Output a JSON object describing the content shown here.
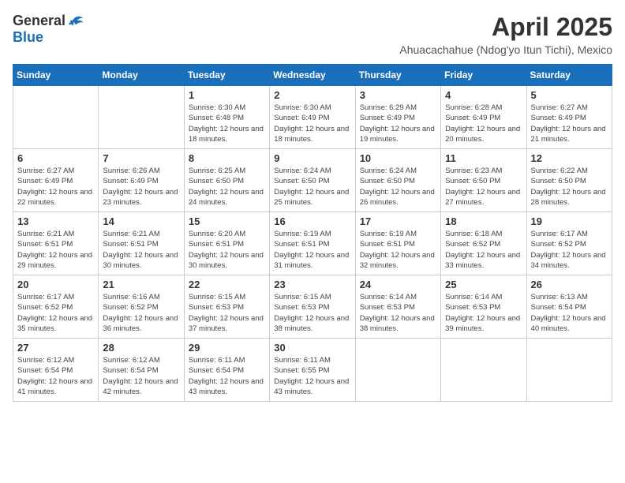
{
  "logo": {
    "general": "General",
    "blue": "Blue"
  },
  "title": "April 2025",
  "location": "Ahuacachahue (Ndog'yo Itun Tichi), Mexico",
  "days_of_week": [
    "Sunday",
    "Monday",
    "Tuesday",
    "Wednesday",
    "Thursday",
    "Friday",
    "Saturday"
  ],
  "weeks": [
    [
      {
        "day": "",
        "info": ""
      },
      {
        "day": "",
        "info": ""
      },
      {
        "day": "1",
        "info": "Sunrise: 6:30 AM\nSunset: 6:48 PM\nDaylight: 12 hours and 18 minutes."
      },
      {
        "day": "2",
        "info": "Sunrise: 6:30 AM\nSunset: 6:49 PM\nDaylight: 12 hours and 18 minutes."
      },
      {
        "day": "3",
        "info": "Sunrise: 6:29 AM\nSunset: 6:49 PM\nDaylight: 12 hours and 19 minutes."
      },
      {
        "day": "4",
        "info": "Sunrise: 6:28 AM\nSunset: 6:49 PM\nDaylight: 12 hours and 20 minutes."
      },
      {
        "day": "5",
        "info": "Sunrise: 6:27 AM\nSunset: 6:49 PM\nDaylight: 12 hours and 21 minutes."
      }
    ],
    [
      {
        "day": "6",
        "info": "Sunrise: 6:27 AM\nSunset: 6:49 PM\nDaylight: 12 hours and 22 minutes."
      },
      {
        "day": "7",
        "info": "Sunrise: 6:26 AM\nSunset: 6:49 PM\nDaylight: 12 hours and 23 minutes."
      },
      {
        "day": "8",
        "info": "Sunrise: 6:25 AM\nSunset: 6:50 PM\nDaylight: 12 hours and 24 minutes."
      },
      {
        "day": "9",
        "info": "Sunrise: 6:24 AM\nSunset: 6:50 PM\nDaylight: 12 hours and 25 minutes."
      },
      {
        "day": "10",
        "info": "Sunrise: 6:24 AM\nSunset: 6:50 PM\nDaylight: 12 hours and 26 minutes."
      },
      {
        "day": "11",
        "info": "Sunrise: 6:23 AM\nSunset: 6:50 PM\nDaylight: 12 hours and 27 minutes."
      },
      {
        "day": "12",
        "info": "Sunrise: 6:22 AM\nSunset: 6:50 PM\nDaylight: 12 hours and 28 minutes."
      }
    ],
    [
      {
        "day": "13",
        "info": "Sunrise: 6:21 AM\nSunset: 6:51 PM\nDaylight: 12 hours and 29 minutes."
      },
      {
        "day": "14",
        "info": "Sunrise: 6:21 AM\nSunset: 6:51 PM\nDaylight: 12 hours and 30 minutes."
      },
      {
        "day": "15",
        "info": "Sunrise: 6:20 AM\nSunset: 6:51 PM\nDaylight: 12 hours and 30 minutes."
      },
      {
        "day": "16",
        "info": "Sunrise: 6:19 AM\nSunset: 6:51 PM\nDaylight: 12 hours and 31 minutes."
      },
      {
        "day": "17",
        "info": "Sunrise: 6:19 AM\nSunset: 6:51 PM\nDaylight: 12 hours and 32 minutes."
      },
      {
        "day": "18",
        "info": "Sunrise: 6:18 AM\nSunset: 6:52 PM\nDaylight: 12 hours and 33 minutes."
      },
      {
        "day": "19",
        "info": "Sunrise: 6:17 AM\nSunset: 6:52 PM\nDaylight: 12 hours and 34 minutes."
      }
    ],
    [
      {
        "day": "20",
        "info": "Sunrise: 6:17 AM\nSunset: 6:52 PM\nDaylight: 12 hours and 35 minutes."
      },
      {
        "day": "21",
        "info": "Sunrise: 6:16 AM\nSunset: 6:52 PM\nDaylight: 12 hours and 36 minutes."
      },
      {
        "day": "22",
        "info": "Sunrise: 6:15 AM\nSunset: 6:53 PM\nDaylight: 12 hours and 37 minutes."
      },
      {
        "day": "23",
        "info": "Sunrise: 6:15 AM\nSunset: 6:53 PM\nDaylight: 12 hours and 38 minutes."
      },
      {
        "day": "24",
        "info": "Sunrise: 6:14 AM\nSunset: 6:53 PM\nDaylight: 12 hours and 38 minutes."
      },
      {
        "day": "25",
        "info": "Sunrise: 6:14 AM\nSunset: 6:53 PM\nDaylight: 12 hours and 39 minutes."
      },
      {
        "day": "26",
        "info": "Sunrise: 6:13 AM\nSunset: 6:54 PM\nDaylight: 12 hours and 40 minutes."
      }
    ],
    [
      {
        "day": "27",
        "info": "Sunrise: 6:12 AM\nSunset: 6:54 PM\nDaylight: 12 hours and 41 minutes."
      },
      {
        "day": "28",
        "info": "Sunrise: 6:12 AM\nSunset: 6:54 PM\nDaylight: 12 hours and 42 minutes."
      },
      {
        "day": "29",
        "info": "Sunrise: 6:11 AM\nSunset: 6:54 PM\nDaylight: 12 hours and 43 minutes."
      },
      {
        "day": "30",
        "info": "Sunrise: 6:11 AM\nSunset: 6:55 PM\nDaylight: 12 hours and 43 minutes."
      },
      {
        "day": "",
        "info": ""
      },
      {
        "day": "",
        "info": ""
      },
      {
        "day": "",
        "info": ""
      }
    ]
  ]
}
